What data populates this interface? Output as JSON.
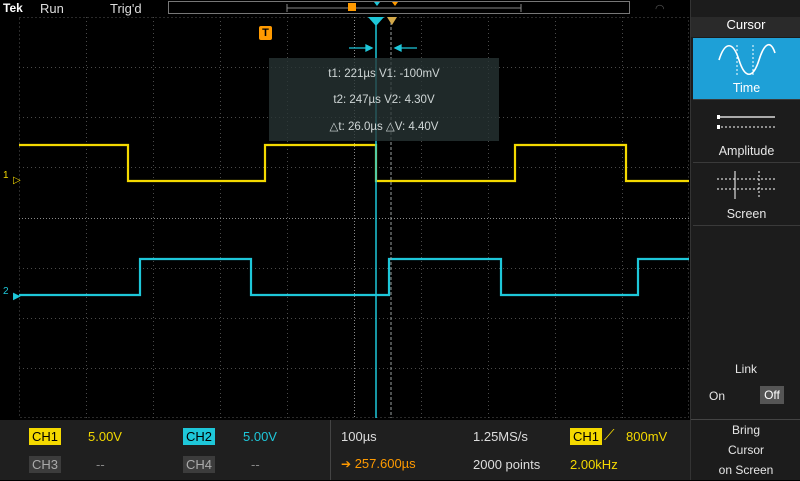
{
  "top": {
    "brand": "Tek",
    "run": "Run",
    "trigger_state": "Trig'd"
  },
  "readout": {
    "line1": "t1: 221µs  V1: -100mV",
    "line2": "t2: 247µs  V2: 4.30V",
    "line3": "△t: 26.0µs  △V: 4.40V"
  },
  "channel_markers": {
    "ch1": "1",
    "ch2": "2"
  },
  "trigger_marker": "T",
  "panel": {
    "title": "Cursor",
    "options": [
      "Time",
      "Amplitude",
      "Screen"
    ],
    "selected": "Time",
    "link_title": "Link",
    "link_on": "On",
    "link_off": "Off",
    "bring_line1": "Bring",
    "bring_line2": "Cursor",
    "bring_line3": "on Screen"
  },
  "bottom": {
    "ch1_label": "CH1",
    "ch1_value": "5.00V",
    "ch2_label": "CH2",
    "ch2_value": "5.00V",
    "ch3_label": "CH3",
    "ch3_value": "--",
    "ch4_label": "CH4",
    "ch4_value": "--",
    "time_div": "100µs",
    "position": "257.600µs",
    "sample_rate": "1.25MS/s",
    "record_length": "2000 points",
    "trig_source": "CH1",
    "trig_level": "800mV",
    "frequency": "2.00kHz"
  },
  "colors": {
    "ch1": "#f4d900",
    "ch2": "#1ec7d9",
    "trigger": "#ff9a00",
    "selected": "#1ea0d7"
  }
}
